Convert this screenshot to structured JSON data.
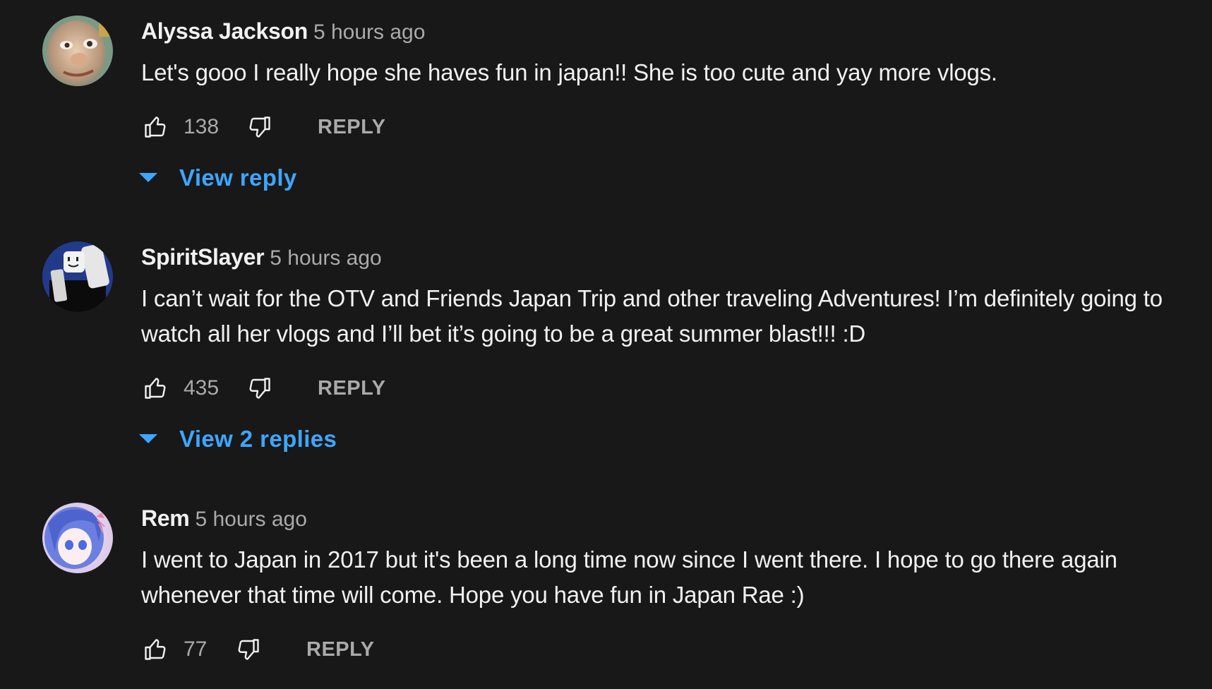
{
  "comments": [
    {
      "author": "Alyssa Jackson",
      "time": "5 hours ago",
      "text": "Let's gooo I really hope she haves fun in japan!! She is too cute and yay more vlogs.",
      "likes": "138",
      "reply_label": "REPLY",
      "view_replies": "View reply",
      "avatar_icon": "face-avatar"
    },
    {
      "author": "SpiritSlayer",
      "time": "5 hours ago",
      "text": "I can’t wait for the OTV and Friends Japan Trip and other traveling Adventures! I’m definitely going to watch all her vlogs and I’ll bet it’s going to be a great summer blast!!! :D",
      "likes": "435",
      "reply_label": "REPLY",
      "view_replies": "View 2 replies",
      "avatar_icon": "roblox-avatar"
    },
    {
      "author": "Rem",
      "time": "5 hours ago",
      "text": "I went to Japan in 2017 but it's been a long time now since I went there. I hope to go there again whenever that time will come. Hope you have fun in Japan Rae :)",
      "likes": "77",
      "reply_label": "REPLY",
      "avatar_icon": "anime-avatar"
    }
  ],
  "colors": {
    "background": "#181818",
    "text": "#f1f1f1",
    "secondary": "#aaaaaa",
    "link": "#3ea6ff"
  }
}
